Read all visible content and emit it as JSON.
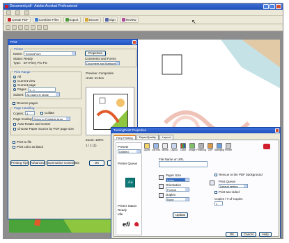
{
  "acrobat": {
    "title": "Document.pdf - Adobe Acrobat Professional",
    "toolbar": {
      "create_pdf": "Create PDF",
      "combine": "Combine Files",
      "export": "Export",
      "secure": "Secure",
      "sign": "Sign",
      "review": "Review"
    }
  },
  "print": {
    "title": "Print",
    "printer_group": "Printer",
    "name_label": "Name:",
    "name_value": "TurningPoint",
    "status_label": "Status:",
    "status_value": "Ready",
    "type_label": "Type:",
    "type_value": "EFI Fiery Pro PS",
    "properties_button": "Properties",
    "comments_label": "Comments and Forms",
    "comments_value": "Document and Markups",
    "range_group": "Print Range",
    "range_all": "All",
    "range_view": "Current view",
    "range_page": "Current page",
    "range_pages": "Pages",
    "pages_value": "1 - 1",
    "subset_label": "Subset:",
    "subset_value": "All pages in range",
    "reverse_pages": "Reverse pages",
    "handling_group": "Page Handling",
    "copies_label": "Copies:",
    "copies_value": "1",
    "collate": "Collate",
    "scaling_label": "Page Scaling:",
    "scaling_value": "Shrink to Printable Area",
    "auto_rotate": "Auto-Rotate and Center",
    "choose_source": "Choose Paper Source by PDF page size",
    "print_file": "Print to file",
    "print_color": "Print color as black",
    "preview_label": "Preview: Composite",
    "units": "Units: Inches",
    "zoom_label": "Zoom: 100%",
    "page_info": "1 / 1 (1)",
    "printing_tips": "Printing Tips",
    "advanced": "Advanced",
    "summarize": "Summarize Comments",
    "ok": "OK",
    "cancel": "Cancel"
  },
  "props": {
    "title": "TurningPoint Properties",
    "tabs": [
      "Fiery Printing",
      "Paper/Quality",
      "Layout"
    ],
    "toolbar_icons": [
      "Quick",
      "Job Info",
      "Media",
      "Layout",
      "Color",
      "Image",
      "Finishing",
      "VDP",
      "Stamping",
      "Printer"
    ],
    "presets_label": "Presets",
    "presets_value": "Untitled",
    "job_name_label": "Job Name",
    "media_label": "Printer Queue",
    "aa_text": "Aa",
    "printer_status_label": "Printer Status",
    "printer_status_value": "Ready",
    "idle": "Idle",
    "efi_logo": "efi",
    "file_name_label": "File Name or URL",
    "paper_size_label": "Paper Size",
    "paper_size_value": "Letter",
    "orientation_label": "Orientation",
    "orientation_value": "Portrait",
    "duplex_label": "Duplex",
    "duplex_value": "None",
    "update_button": "Update",
    "reset_option": "Reset to Default",
    "pdf_background": "Rescue to the PDF background",
    "print_queue_label": "Print Queue",
    "print_queue_value": "Default setting",
    "two_sided": "Print two-sided",
    "staple": "Staple",
    "collate": "Collate",
    "copies_label": "Copies / # of Copies",
    "copies_value": "1",
    "ok": "OK",
    "cancel": "Cancel",
    "help": "Help"
  }
}
